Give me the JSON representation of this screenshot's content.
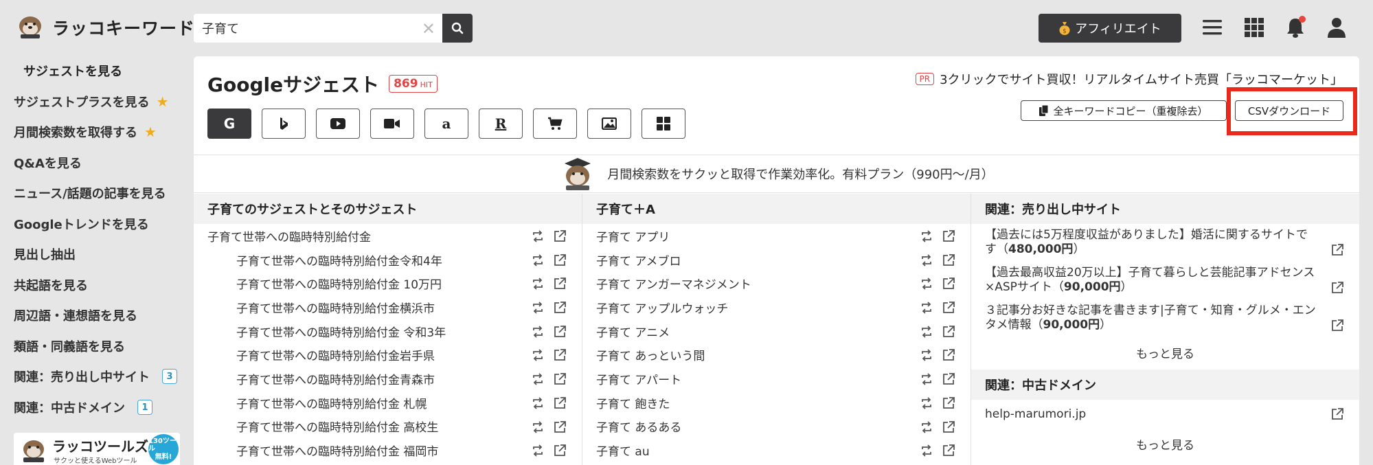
{
  "header": {
    "logo_text": "ラッコキーワード",
    "search": {
      "value": "子育て",
      "clear": "✕"
    },
    "affiliate_label": "アフィリエイト"
  },
  "sidebar": {
    "items": [
      {
        "label": "サジェストを見る"
      },
      {
        "label": "サジェストプラスを見る",
        "star": true
      },
      {
        "label": "月間検索数を取得する",
        "star": true
      },
      {
        "label": "Q&Aを見る"
      },
      {
        "label": "ニュース/話題の記事を見る"
      },
      {
        "label": "Googleトレンドを見る"
      },
      {
        "label": "見出し抽出"
      },
      {
        "label": "共起語を見る"
      },
      {
        "label": "周辺語・連想語を見る"
      },
      {
        "label": "類語・同義語を見る"
      },
      {
        "label": "関連：売り出し中サイト",
        "count": "3"
      },
      {
        "label": "関連：中古ドメイン",
        "count": "1"
      }
    ],
    "banner": {
      "title": "ラッコツールズ",
      "subtitle": "サクッと使えるWebツール",
      "tag_line1": "130ツール",
      "tag_line2": "無料!"
    }
  },
  "main": {
    "title": "Googleサジェスト",
    "hit_count": "869",
    "hit_unit": "HIT",
    "pr": {
      "tag": "PR",
      "text": "3クリックでサイト買収！リアルタイムサイト売買「ラッコマーケット」"
    },
    "copy_button": "全キーワードコピー（重複除去）",
    "csv_button": "CSVダウンロード",
    "engines": [
      "G",
      "b",
      "youtube",
      "video",
      "a",
      "R",
      "cart",
      "image",
      "grid"
    ],
    "promo_text": "月間検索数をサクッと取得で作業効率化。有料プラン（990円〜/月）"
  },
  "columns": {
    "suggest": {
      "header": "子育てのサジェストとそのサジェスト",
      "rows": [
        "子育て世帯への臨時特別給付金",
        "子育て世帯への臨時特別給付金令和4年",
        "子育て世帯への臨時特別給付金 10万円",
        "子育て世帯への臨時特別給付金横浜市",
        "子育て世帯への臨時特別給付金 令和3年",
        "子育て世帯への臨時特別給付金岩手県",
        "子育て世帯への臨時特別給付金青森市",
        "子育て世帯への臨時特別給付金 札幌",
        "子育て世帯への臨時特別給付金 高校生",
        "子育て世帯への臨時特別給付金 福岡市"
      ]
    },
    "plus_a": {
      "header": "子育て＋A",
      "rows": [
        "子育て アプリ",
        "子育て アメブロ",
        "子育て アンガーマネジメント",
        "子育て アップルウォッチ",
        "子育て アニメ",
        "子育て あっという間",
        "子育て アパート",
        "子育て 飽きた",
        "子育て あるある",
        "子育て au"
      ]
    },
    "related": {
      "header": "関連：売り出し中サイト",
      "sites": [
        {
          "text": "【過去には5万程度収益がありました】婚活に関するサイトです",
          "price": "480,000円"
        },
        {
          "text": "【過去最高収益20万以上】子育て暮らしと芸能記事アドセンス×ASPサイト",
          "price": "90,000円"
        },
        {
          "text": "３記事分お好きな記事を書きます|子育て・知育・グルメ・エンタメ情報",
          "price": "90,000円"
        }
      ],
      "more": "もっと見る",
      "domain_header": "関連：中古ドメイン",
      "domains": [
        "help-marumori.jp"
      ],
      "domain_more": "もっと見る"
    }
  }
}
